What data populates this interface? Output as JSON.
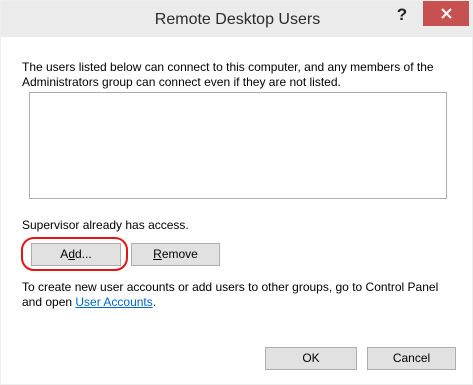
{
  "window": {
    "title": "Remote Desktop Users",
    "help_glyph": "?",
    "close_icon": "close-icon"
  },
  "description": {
    "line1": "The users listed below can connect to this computer, and any members of the",
    "line2": "Administrators group can connect even if they are not listed."
  },
  "user_list": [],
  "access_note": "Supervisor already has access.",
  "buttons": {
    "add_pre": "A",
    "add_mnemonic": "d",
    "add_post": "d...",
    "remove_mnemonic": "R",
    "remove_post": "emove",
    "ok": "OK",
    "cancel": "Cancel"
  },
  "info": {
    "line1": "To create new user accounts or add users to other groups, go to Control Panel",
    "line2_pre": "and open ",
    "link": "User Accounts",
    "line2_post": "."
  },
  "colors": {
    "close_button": "#c75050",
    "link": "#0066cc",
    "highlight_ring": "#e01515"
  }
}
